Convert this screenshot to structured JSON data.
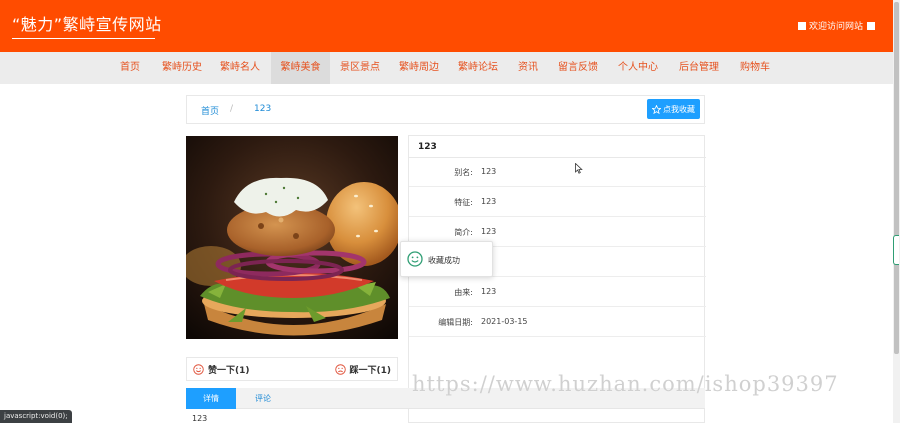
{
  "header": {
    "title": "“魅力”繁峙宣传网站",
    "welcome": "欢迎访问网站"
  },
  "nav": {
    "items": [
      {
        "label": "首页"
      },
      {
        "label": "繁峙历史"
      },
      {
        "label": "繁峙名人"
      },
      {
        "label": "繁峙美食"
      },
      {
        "label": "景区景点"
      },
      {
        "label": "繁峙周边"
      },
      {
        "label": "繁峙论坛"
      },
      {
        "label": "资讯"
      },
      {
        "label": "留言反馈"
      },
      {
        "label": "个人中心"
      },
      {
        "label": "后台管理"
      },
      {
        "label": "购物车"
      }
    ],
    "active": "繁峙美食"
  },
  "breadcrumb": {
    "home": "首页",
    "separator": "/",
    "current": "123"
  },
  "favorite_button": "点我收藏",
  "detail": {
    "title": "123",
    "rows": [
      {
        "label": "别名:",
        "value": "123"
      },
      {
        "label": "特征:",
        "value": "123"
      },
      {
        "label": "简介:",
        "value": "123"
      },
      {
        "label": "",
        "value": ""
      },
      {
        "label": "由来:",
        "value": "123"
      },
      {
        "label": "编辑日期:",
        "value": "2021-03-15"
      }
    ]
  },
  "votes": {
    "up": "赞一下(1)",
    "down": "踩一下(1)"
  },
  "toast": {
    "message": "收藏成功",
    "icon": "smile-icon"
  },
  "tabs": [
    {
      "label": "详情"
    },
    {
      "label": "评论"
    }
  ],
  "tab_content": "123",
  "status_bar": "javascript:void(0);",
  "watermark": "https://www.huzhan.com/ishop39397",
  "colors": {
    "header_bg": "#ff4c00",
    "nav_text": "#e6521f",
    "primary": "#1e9fff",
    "success": "#2f9e74",
    "vote_icon": "#e0523a"
  }
}
